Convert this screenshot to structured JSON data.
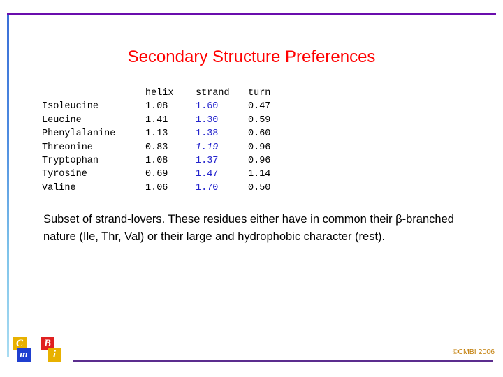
{
  "slide": {
    "title": "Secondary Structure Preferences",
    "title_color": "#ff0000"
  },
  "table": {
    "headers": [
      "",
      "helix",
      "strand",
      "turn"
    ],
    "rows": [
      {
        "name": "Isoleucine",
        "helix": "1.08",
        "strand": "1.60",
        "turn": "0.47",
        "strand_italic": false
      },
      {
        "name": "Leucine",
        "helix": "1.41",
        "strand": "1.30",
        "turn": "0.59",
        "strand_italic": false
      },
      {
        "name": "Phenylalanine",
        "helix": "1.13",
        "strand": "1.38",
        "turn": "0.60",
        "strand_italic": false
      },
      {
        "name": "Threonine",
        "helix": "0.83",
        "strand": "1.19",
        "turn": "0.96",
        "strand_italic": true
      },
      {
        "name": "Tryptophan",
        "helix": "1.08",
        "strand": "1.37",
        "turn": "0.96",
        "strand_italic": false
      },
      {
        "name": "Tyrosine",
        "helix": "0.69",
        "strand": "1.47",
        "turn": "1.14",
        "strand_italic": false
      },
      {
        "name": "Valine",
        "helix": "1.06",
        "strand": "1.70",
        "turn": "0.50",
        "strand_italic": false
      }
    ],
    "strand_color": "#2222cc"
  },
  "body": {
    "paragraph_part1": "Subset of strand-lovers. These residues either have in common their ",
    "beta_symbol": "β",
    "paragraph_part2": "-branched nature (Ile, Thr, Val) or their large and hydrophobic character (rest)."
  },
  "logo": {
    "letters": [
      "C",
      "m",
      "B",
      "i"
    ],
    "colors": [
      "#e8b100",
      "#1f3fd0",
      "#e02020",
      "#e8b100"
    ]
  },
  "footer": {
    "copyright": "©CMBI 2006",
    "copyright_color": "#c07a00"
  }
}
